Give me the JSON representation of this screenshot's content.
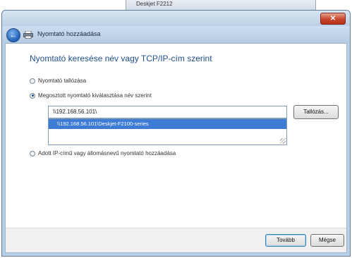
{
  "background_window": {
    "title": "Deskjet F2212"
  },
  "dialog": {
    "close_label": "✕",
    "nav_title": "Nyomtató hozzáadása",
    "heading": "Nyomtató keresése név vagy TCP/IP-cím szerint",
    "options": [
      {
        "label": "Nyomtató tallózása",
        "checked": false
      },
      {
        "label": "Megosztott nyomtató kiválasztása név szerint",
        "checked": true
      },
      {
        "label": "Adott IP-című vagy állomásnevű nyomtató hozzáadása",
        "checked": false
      }
    ],
    "input_value": "\\\\192.168.56.101\\",
    "browse_label": "Tallózás...",
    "suggestion": "\\\\192.168.56.101\\Deskjet-F2100-series",
    "next_label": "Tovább",
    "cancel_label": "Mégse"
  },
  "colors": {
    "heading": "#1f4f8c",
    "selection": "#3d7bd4",
    "close_button": "#c8452c"
  }
}
